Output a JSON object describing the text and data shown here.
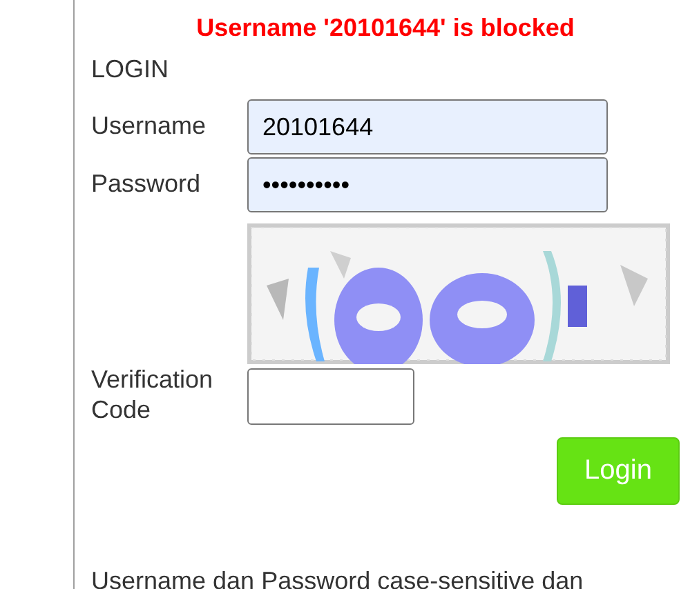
{
  "error_message": "Username '20101644' is blocked",
  "form": {
    "title": "LOGIN",
    "fields": [
      {
        "label": "Username",
        "value": "20101644"
      },
      {
        "label": "Password",
        "value": "••••••••••"
      }
    ],
    "verification": {
      "label": "Verification Code"
    },
    "submit": "Login"
  },
  "note": "Username dan Password case-sensitive dan"
}
